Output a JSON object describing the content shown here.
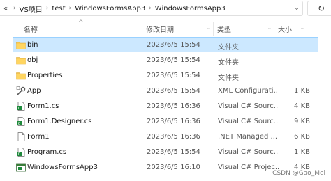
{
  "address_bar": {
    "overflow_label": "«",
    "crumbs": [
      "VS项目",
      "test",
      "WindowsFormsApp3",
      "WindowsFormsApp3"
    ],
    "separator": "›",
    "dropdown": "⌄",
    "refresh": "↻"
  },
  "columns": {
    "name": "名称",
    "date": "修改日期",
    "type": "类型",
    "size": "大小",
    "sort_arrow": "^",
    "chevron": "⌄"
  },
  "files": [
    {
      "name": "bin",
      "date": "2023/6/5 15:54",
      "type": "文件夹",
      "size": "",
      "icon": "folder-icon",
      "selected": true
    },
    {
      "name": "obj",
      "date": "2023/6/5 15:54",
      "type": "文件夹",
      "size": "",
      "icon": "folder-icon",
      "selected": false
    },
    {
      "name": "Properties",
      "date": "2023/6/5 15:54",
      "type": "文件夹",
      "size": "",
      "icon": "folder-icon",
      "selected": false
    },
    {
      "name": "App",
      "date": "2023/6/5 15:54",
      "type": "XML Configurati...",
      "size": "1 KB",
      "icon": "config-file-icon",
      "selected": false
    },
    {
      "name": "Form1.cs",
      "date": "2023/6/5 16:36",
      "type": "Visual C# Sourc...",
      "size": "4 KB",
      "icon": "csharp-file-icon",
      "selected": false
    },
    {
      "name": "Form1.Designer.cs",
      "date": "2023/6/5 16:36",
      "type": "Visual C# Sourc...",
      "size": "9 KB",
      "icon": "csharp-file-icon",
      "selected": false
    },
    {
      "name": "Form1",
      "date": "2023/6/5 16:36",
      "type": ".NET Managed ...",
      "size": "6 KB",
      "icon": "resx-file-icon",
      "selected": false
    },
    {
      "name": "Program.cs",
      "date": "2023/6/5 15:54",
      "type": "Visual C# Sourc...",
      "size": "1 KB",
      "icon": "csharp-file-icon",
      "selected": false
    },
    {
      "name": "WindowsFormsApp3",
      "date": "2023/6/5 16:10",
      "type": "Visual C# Projec...",
      "size": "4 KB",
      "icon": "csproj-file-icon",
      "selected": false
    }
  ],
  "watermark": "CSDN @Gao_Mei",
  "colors": {
    "selection_bg": "#cce8ff",
    "selection_border": "#99d1ff",
    "folder": "#f4c44e"
  }
}
